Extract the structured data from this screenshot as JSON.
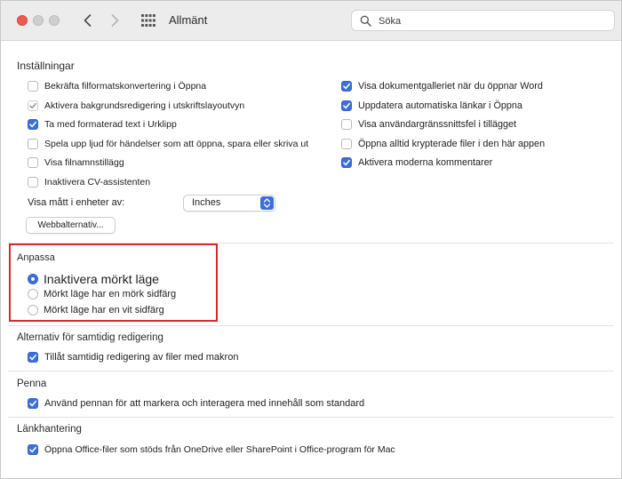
{
  "window": {
    "title": "Allmänt"
  },
  "search": {
    "placeholder": "Söka"
  },
  "sections": {
    "settings": {
      "label": "Inställningar",
      "left": [
        {
          "label": "Bekräfta filformatskonvertering i Öppna",
          "checked": false
        },
        {
          "label": "Aktivera bakgrundsredigering i utskriftslayoutvyn",
          "checked": true,
          "dimmed": true
        },
        {
          "label": "Ta med formaterad text i Urklipp",
          "checked": true
        },
        {
          "label": "Spela upp ljud för händelser som att öppna, spara eller skriva ut",
          "checked": false
        },
        {
          "label": "Visa filnamnstillägg",
          "checked": false
        },
        {
          "label": "Inaktivera CV-assistenten",
          "checked": false
        }
      ],
      "right": [
        {
          "label": "Visa dokumentgalleriet när du öppnar Word",
          "checked": true
        },
        {
          "label": "Uppdatera automatiska länkar i Öppna",
          "checked": true
        },
        {
          "label": "Visa användargränssnittsfel i tillägget",
          "checked": false
        },
        {
          "label": "Öppna alltid krypterade filer i den här appen",
          "checked": false
        },
        {
          "label": "Aktivera moderna kommentarer",
          "checked": true
        }
      ],
      "units_label": "Visa mått i enheter av:",
      "units_value": "Inches",
      "web_button": "Webbalternativ..."
    },
    "customize": {
      "label": "Anpassa",
      "options": [
        {
          "label": "Inaktivera mörkt läge",
          "selected": true
        },
        {
          "label": "Mörkt läge har en mörk sidfärg",
          "selected": false
        },
        {
          "label": "Mörkt läge har en vit sidfärg",
          "selected": false
        }
      ]
    },
    "coauthoring": {
      "label": "Alternativ för samtidig redigering",
      "option": {
        "label": "Tillåt samtidig redigering av filer med makron",
        "checked": true
      }
    },
    "pen": {
      "label": "Penna",
      "option": {
        "label": "Använd pennan för att markera och interagera med innehåll som standard",
        "checked": true
      }
    },
    "linking": {
      "label": "Länkhantering",
      "option": {
        "label": "Öppna Office-filer som stöds från OneDrive eller SharePoint i Office-program för Mac",
        "checked": true
      }
    }
  },
  "colors": {
    "accent": "#3b6fd8",
    "highlight": "#d42b2b"
  }
}
